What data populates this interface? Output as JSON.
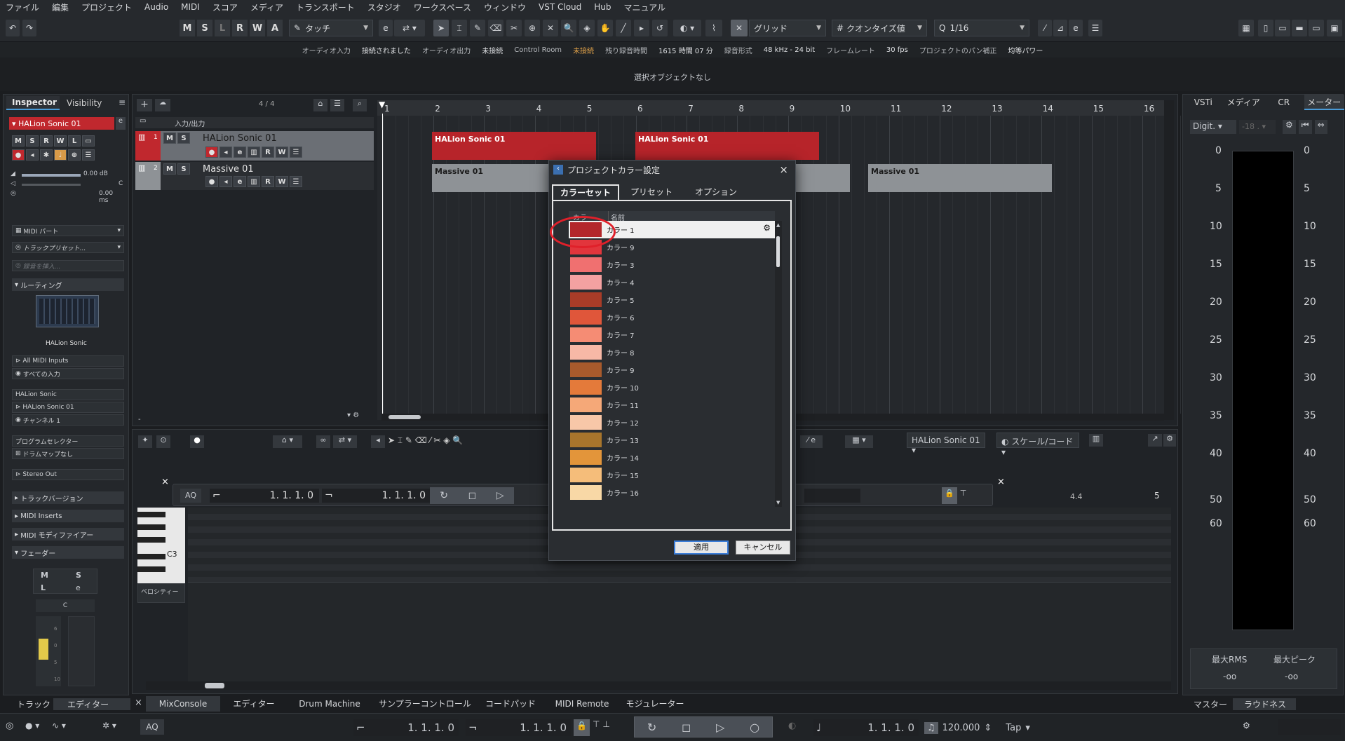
{
  "menubar": [
    "ファイル",
    "編集",
    "プロジェクト",
    "Audio",
    "MIDI",
    "スコア",
    "メディア",
    "トランスポート",
    "スタジオ",
    "ワークスペース",
    "ウィンドウ",
    "VST Cloud",
    "Hub",
    "マニュアル"
  ],
  "toolbar": {
    "msl": [
      "M",
      "S",
      "L",
      "R",
      "W",
      "A"
    ],
    "automation_mode": "タッチ",
    "snap_type": "グリッド",
    "quantize_label": "クオンタイズ値",
    "quantize_value": "1/16"
  },
  "status": {
    "audio_in_label": "オーディオ入力",
    "audio_in_value": "接続されました",
    "audio_out_label": "オーディオ出力",
    "audio_out_value": "未接続",
    "control_room_label": "Control Room",
    "control_room_value": "未接続",
    "rec_time_label": "残り録音時間",
    "rec_time_value": "1615 時間 07 分",
    "rec_format_label": "録音形式",
    "rec_format_value": "48 kHz - 24 bit",
    "frame_rate_label": "フレームレート",
    "frame_rate_value": "30 fps",
    "pan_label": "プロジェクトのパン補正",
    "pan_value": "均等パワー"
  },
  "info_line": "選択オブジェクトなし",
  "inspector": {
    "tab_inspector": "Inspector",
    "tab_visibility": "Visibility",
    "track_name": "HALion Sonic 01",
    "volume": "0.00 dB",
    "pan": "C",
    "delay": "0.00 ms",
    "midi_part": "MIDI パート",
    "track_preset": "トラックプリセット...",
    "insert_placeholder": "録音を挿入...",
    "routing": "ルーティング",
    "instrument_name": "HALion Sonic",
    "midi_in": "All MIDI Inputs",
    "all_inputs": "すべての入力",
    "out_instrument": "HALion Sonic",
    "out_instance": "HALion Sonic 01",
    "channel": "チャンネル 1",
    "program_selector": "プログラムセレクター",
    "drum_map": "ドラムマップなし",
    "stereo_out": "Stereo Out",
    "track_version": "トラックバージョン",
    "midi_inserts": "MIDI Inserts",
    "midi_modifier": "MIDI モディファイアー",
    "fader": "フェーダー",
    "fader_m": "M",
    "fader_s": "S",
    "fader_l": "L",
    "fader_e": "e",
    "fader_pan": "C",
    "fader_scale": [
      "6",
      "0",
      "5",
      "10"
    ]
  },
  "tracklist": {
    "counter": "4 / 4",
    "folder": "入力/出力",
    "tracks": [
      {
        "num": "1",
        "name": "HALion Sonic 01"
      },
      {
        "num": "2",
        "name": "Massive 01"
      }
    ],
    "m_label": "M",
    "s_label": "S",
    "r_label": "R",
    "w_label": "W"
  },
  "ruler": [
    "1",
    "2",
    "3",
    "4",
    "5",
    "6",
    "7",
    "8",
    "9",
    "10",
    "11",
    "12",
    "13",
    "14",
    "15",
    "16"
  ],
  "clips": {
    "halion_clips": [
      "HALion Sonic 01",
      "HALion Sonic 01"
    ],
    "massive_clips": [
      "Massive 01",
      "Massive 01"
    ]
  },
  "editor": {
    "instrument": "HALion Sonic 01",
    "scale_chord": "スケール/コード",
    "aq": "AQ",
    "pos_left": "1. 1. 1.  0",
    "pos_right": "1. 1. 1.  0",
    "note_c3": "C3",
    "velocity": "ベロシティー",
    "ruler_4_4": "4.4",
    "ruler_5": "5"
  },
  "dialog": {
    "title": "プロジェクトカラー設定",
    "tabs": [
      "カラーセット",
      "プリセット",
      "オプション"
    ],
    "col_color": "カラー",
    "col_name": "名前",
    "colors": [
      {
        "name": "カラー 1",
        "hex": "#b3272b"
      },
      {
        "name": "カラー 9",
        "hex": "#e2353c"
      },
      {
        "name": "カラー 3",
        "hex": "#f07070"
      },
      {
        "name": "カラー 4",
        "hex": "#f4a1a1"
      },
      {
        "name": "カラー 5",
        "hex": "#a83c28"
      },
      {
        "name": "カラー 6",
        "hex": "#e0563a"
      },
      {
        "name": "カラー 7",
        "hex": "#f58c74"
      },
      {
        "name": "カラー 8",
        "hex": "#f7b8a6"
      },
      {
        "name": "カラー 9",
        "hex": "#a85a2c"
      },
      {
        "name": "カラー 10",
        "hex": "#e47a3a"
      },
      {
        "name": "カラー 11",
        "hex": "#f5a878"
      },
      {
        "name": "カラー 12",
        "hex": "#f8c7a8"
      },
      {
        "name": "カラー 13",
        "hex": "#a8752c"
      },
      {
        "name": "カラー 14",
        "hex": "#e3953a"
      },
      {
        "name": "カラー 15",
        "hex": "#f5bd7a"
      },
      {
        "name": "カラー 16",
        "hex": "#f8d8a6"
      }
    ],
    "apply": "適用",
    "cancel": "キャンセル"
  },
  "right_zone": {
    "tabs": [
      "VSTi",
      "メディア",
      "CR",
      "メーター"
    ],
    "meter_type": "Digit.",
    "meter_value": "-18 .",
    "scale": [
      "0",
      "5",
      "10",
      "15",
      "20",
      "25",
      "30",
      "35",
      "40",
      "50",
      "60"
    ],
    "max_rms_label": "最大RMS",
    "max_peak_label": "最大ピーク",
    "max_rms_value": "-oo",
    "max_peak_value": "-oo",
    "bottom_tabs": [
      "マスター",
      "ラウドネス"
    ]
  },
  "bottom_tabs": {
    "left": [
      "トラック",
      "エディター"
    ],
    "center": [
      "MixConsole",
      "エディター",
      "Drum Machine",
      "サンプラーコントロール",
      "コードパッド",
      "MIDI Remote",
      "モジュレーター"
    ]
  },
  "transport": {
    "aq": "AQ",
    "left_locator": "1. 1. 1.  0",
    "right_locator": "1. 1. 1.  0",
    "position": "1. 1. 1.  0",
    "tempo": "120.000",
    "tap": "Tap"
  },
  "colors": {
    "accent_red": "#c0282e",
    "clip_red": "#b7242a",
    "clip_grey": "#8e9296",
    "highlight_circle": "#e0202a",
    "warning": "#e2a34a"
  }
}
